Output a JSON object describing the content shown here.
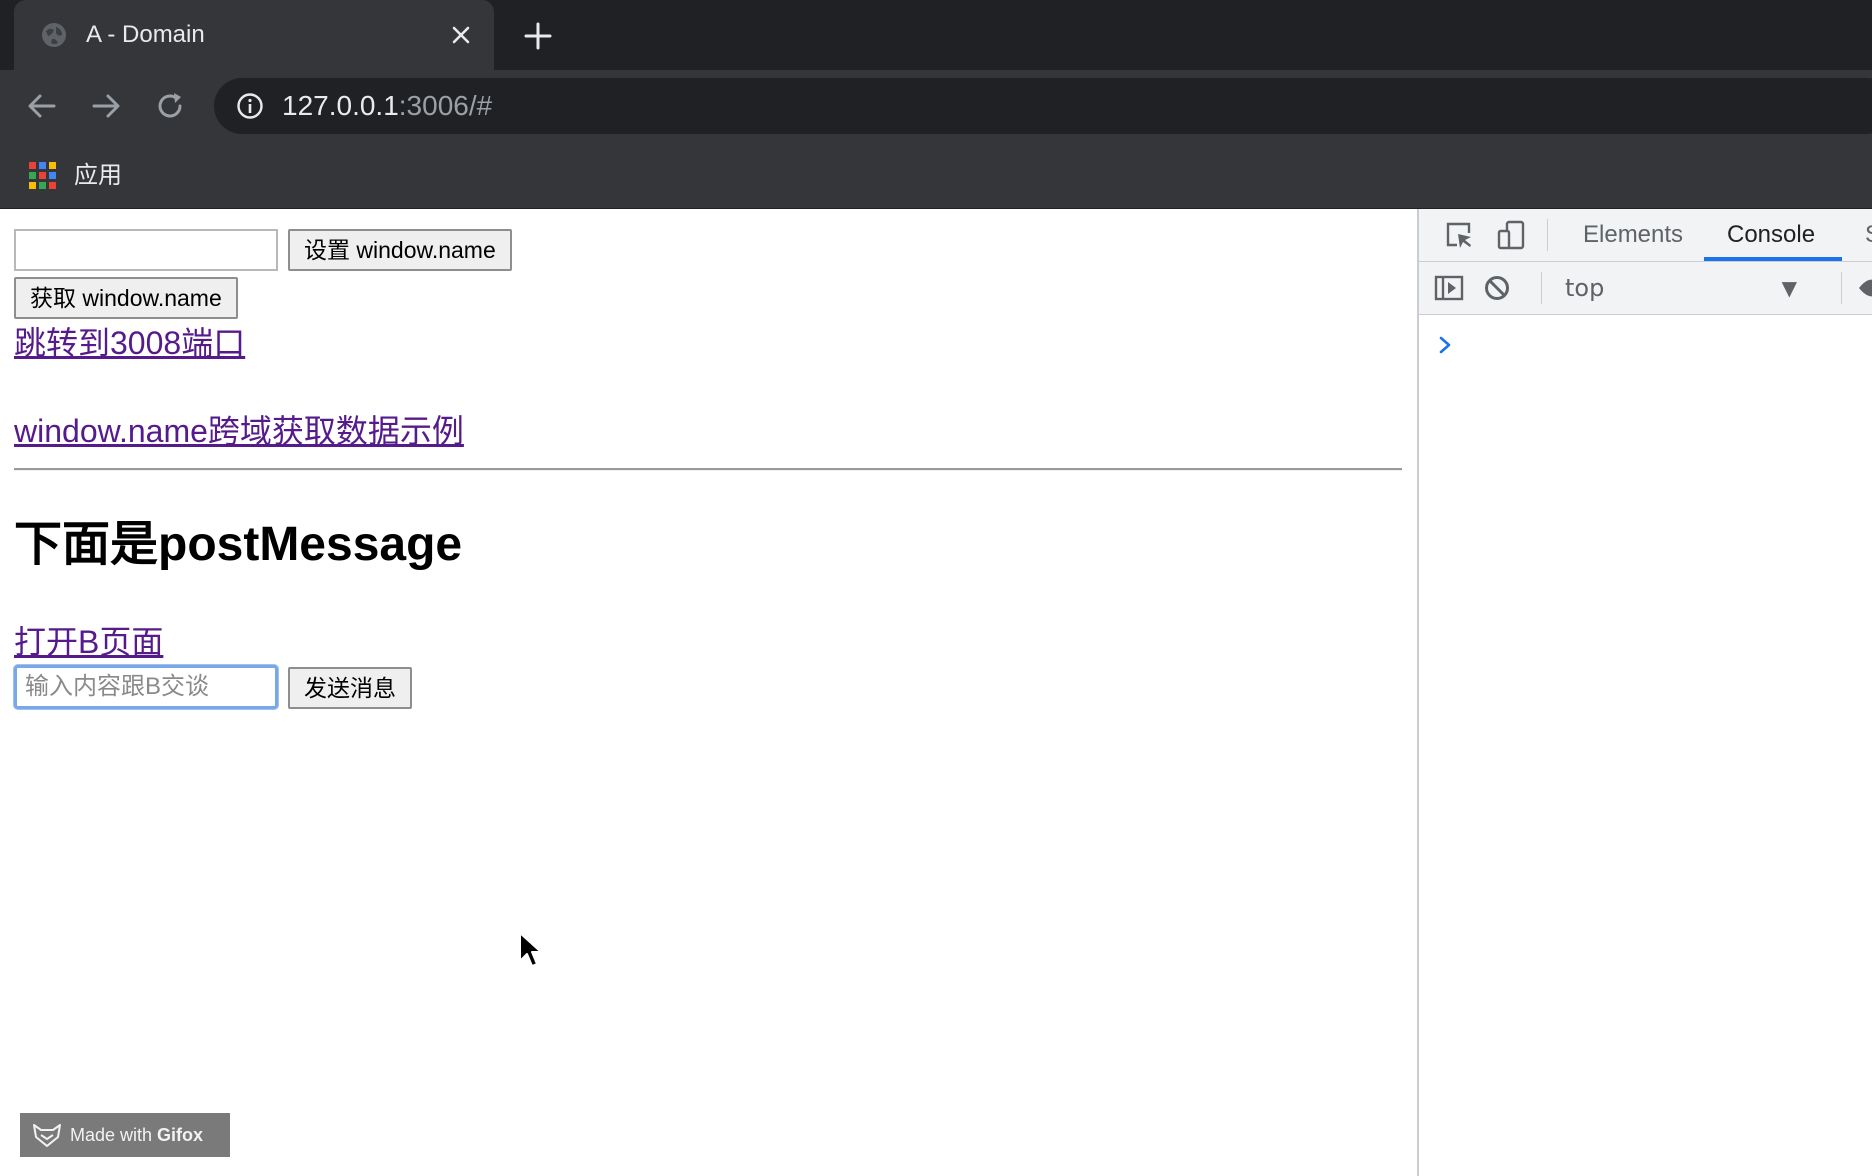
{
  "browser": {
    "tab_title": "A - Domain",
    "url_host": "127.0.0.1",
    "url_rest": ":3006/#",
    "bookmarks": {
      "apps_label": "应用"
    }
  },
  "page": {
    "name_input_value": "",
    "set_name_button": "设置 window.name",
    "get_name_button": "获取 window.name",
    "link_port_3008": "跳转到3008端口",
    "link_example": "window.name跨域获取数据示例",
    "postmessage_heading": "下面是postMessage",
    "link_open_b": "打开B页面",
    "message_input_placeholder": "输入内容跟B交谈",
    "send_button": "发送消息"
  },
  "devtools": {
    "tabs": [
      "Elements",
      "Console",
      "S"
    ],
    "active_tab": "Console",
    "context": "top"
  },
  "watermark": {
    "prefix": "Made with ",
    "brand": "Gifox"
  },
  "colors": {
    "chrome_dark": "#202124",
    "chrome_toolbar": "#35363a",
    "link_visited": "#551a8b",
    "devtools_accent": "#1a73e8"
  }
}
